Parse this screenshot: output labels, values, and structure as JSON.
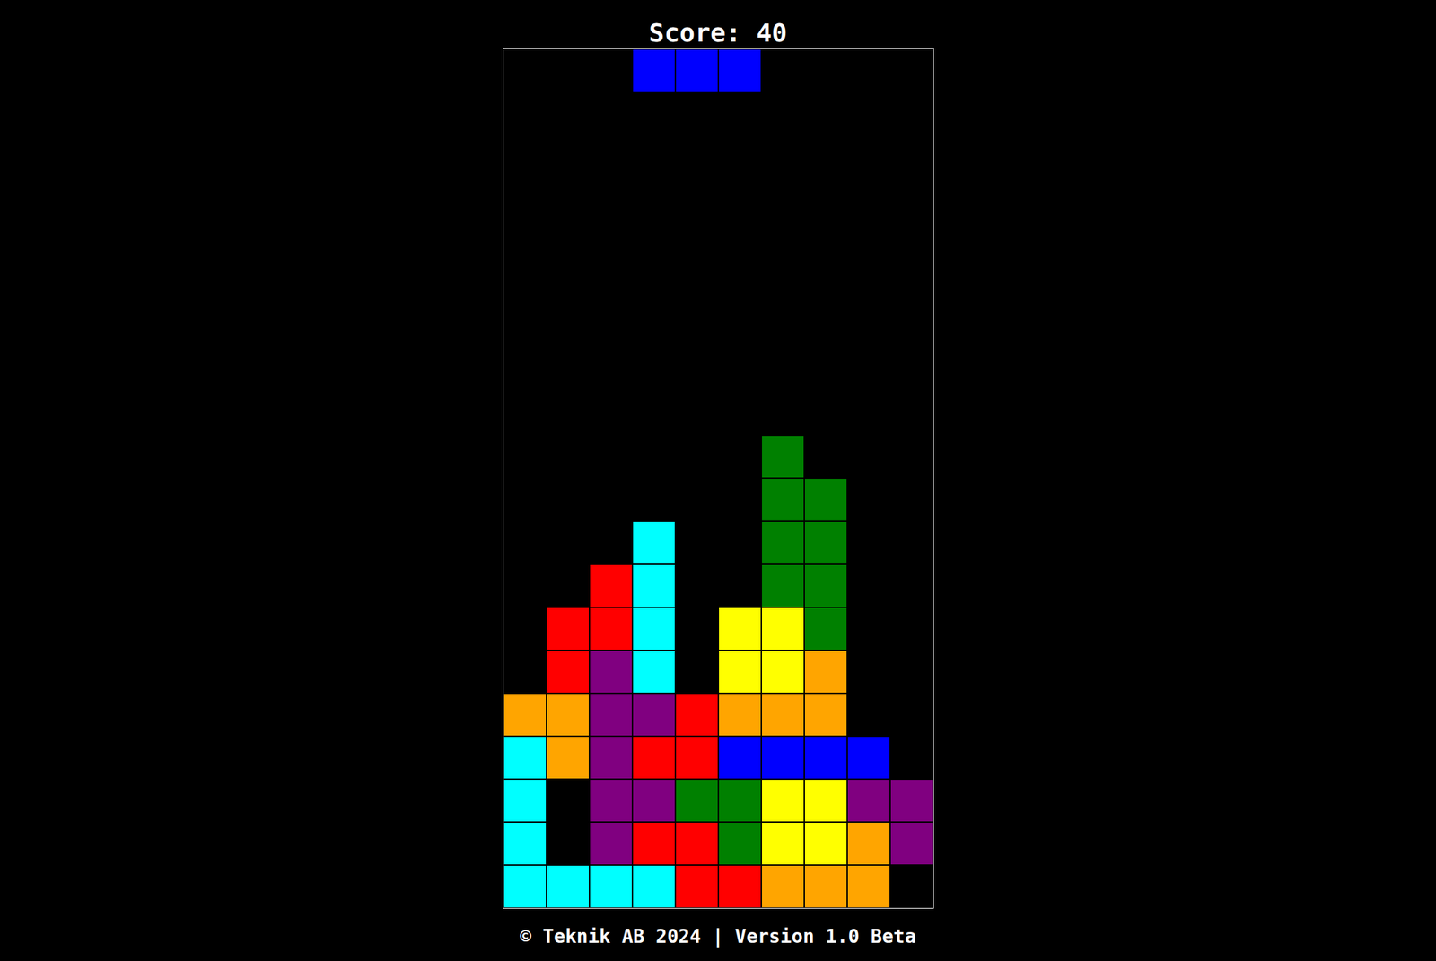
{
  "score_text": "Score: 40",
  "footer_text": "© Teknik AB 2024 | Version 1.0 Beta",
  "active_piece": {
    "color": "#0000ff",
    "cells": [
      [
        0,
        3
      ],
      [
        0,
        4
      ],
      [
        0,
        5
      ]
    ]
  },
  "board": {
    "columns": 10,
    "rows": [
      [
        "",
        "",
        "",
        "",
        "",
        "",
        "",
        "",
        "",
        ""
      ],
      [
        "",
        "",
        "",
        "",
        "",
        "",
        "",
        "",
        "",
        ""
      ],
      [
        "",
        "",
        "",
        "",
        "",
        "",
        "",
        "",
        "",
        ""
      ],
      [
        "",
        "",
        "",
        "",
        "",
        "",
        "",
        "",
        "",
        ""
      ],
      [
        "",
        "",
        "",
        "",
        "",
        "",
        "",
        "",
        "",
        ""
      ],
      [
        "",
        "",
        "",
        "",
        "",
        "",
        "",
        "",
        "",
        ""
      ],
      [
        "",
        "",
        "",
        "",
        "",
        "",
        "",
        "",
        "",
        ""
      ],
      [
        "",
        "",
        "",
        "",
        "",
        "",
        "",
        "",
        "",
        ""
      ],
      [
        "",
        "",
        "",
        "",
        "",
        "",
        "",
        "",
        "",
        ""
      ],
      [
        "",
        "",
        "",
        "",
        "",
        "",
        "#008000",
        "",
        "",
        ""
      ],
      [
        "",
        "",
        "",
        "",
        "",
        "",
        "#008000",
        "#008000",
        "",
        ""
      ],
      [
        "",
        "",
        "",
        "#00ffff",
        "",
        "",
        "#008000",
        "#008000",
        "",
        ""
      ],
      [
        "",
        "",
        "#ff0000",
        "#00ffff",
        "",
        "",
        "#008000",
        "#008000",
        "",
        ""
      ],
      [
        "",
        "#ff0000",
        "#ff0000",
        "#00ffff",
        "",
        "#ffff00",
        "#ffff00",
        "#008000",
        "",
        ""
      ],
      [
        "",
        "#ff0000",
        "#800080",
        "#00ffff",
        "",
        "#ffff00",
        "#ffff00",
        "#ffa500",
        "",
        ""
      ],
      [
        "#ffa500",
        "#ffa500",
        "#800080",
        "#800080",
        "#ff0000",
        "#ffa500",
        "#ffa500",
        "#ffa500",
        "",
        ""
      ],
      [
        "#00ffff",
        "#ffa500",
        "#800080",
        "#ff0000",
        "#ff0000",
        "#0000ff",
        "#0000ff",
        "#0000ff",
        "#0000ff",
        ""
      ],
      [
        "#00ffff",
        "",
        "#800080",
        "#800080",
        "#008000",
        "#008000",
        "#ffff00",
        "#ffff00",
        "#800080",
        "#800080"
      ],
      [
        "#00ffff",
        "",
        "#800080",
        "#ff0000",
        "#ff0000",
        "#008000",
        "#ffff00",
        "#ffff00",
        "#ffa500",
        "#800080"
      ],
      [
        "#00ffff",
        "#00ffff",
        "#00ffff",
        "#00ffff",
        "#ff0000",
        "#ff0000",
        "#ffa500",
        "#ffa500",
        "#ffa500",
        ""
      ]
    ]
  }
}
